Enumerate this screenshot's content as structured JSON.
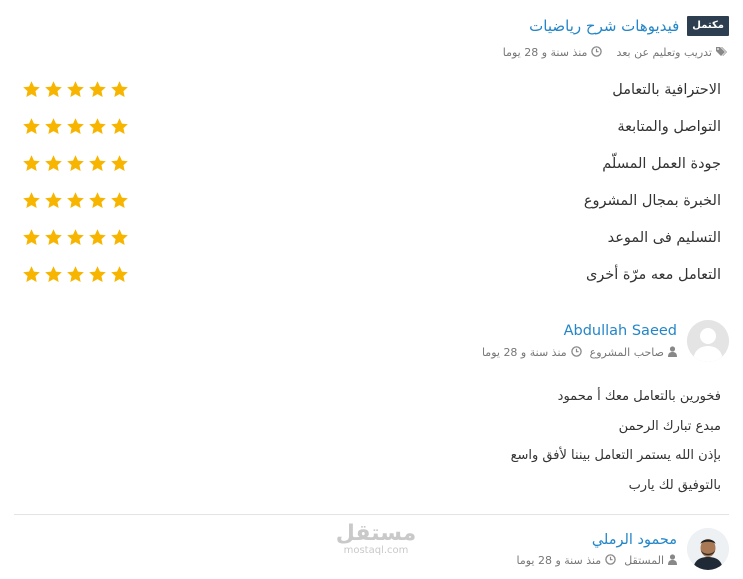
{
  "project": {
    "badge": "مكتمل",
    "title": "فيديوهات شرح رياضيات",
    "category": "تدريب وتعليم عن بعد",
    "time": "منذ سنة و 28 يوما",
    "category_icon": "tags-icon",
    "time_icon": "clock-icon"
  },
  "ratings": [
    {
      "label": "الاحترافية بالتعامل",
      "stars": 5
    },
    {
      "label": "التواصل والمتابعة",
      "stars": 5
    },
    {
      "label": "جودة العمل المسلّم",
      "stars": 5
    },
    {
      "label": "الخبرة بمجال المشروع",
      "stars": 5
    },
    {
      "label": "التسليم فى الموعد",
      "stars": 5
    },
    {
      "label": "التعامل معه مرّة أخرى",
      "stars": 5
    }
  ],
  "star_color": "#f7b500",
  "review": {
    "name": "Abdullah Saeed",
    "role": "صاحب المشروع",
    "time": "منذ سنة و 28 يوما",
    "lines": [
      "فخورين بالتعامل معك أ محمود",
      "مبدع تبارك الرحمن",
      "بإذن الله يستمر التعامل بيننا لأفق واسع",
      "بالتوفيق لك يارب"
    ]
  },
  "freelancer": {
    "name": "محمود الرملي",
    "role": "المستقل",
    "time": "منذ سنة و 28 يوما"
  },
  "watermark": {
    "arabic": "مستقل",
    "english": "mostaql.com"
  },
  "accent_color": "#2386c8"
}
